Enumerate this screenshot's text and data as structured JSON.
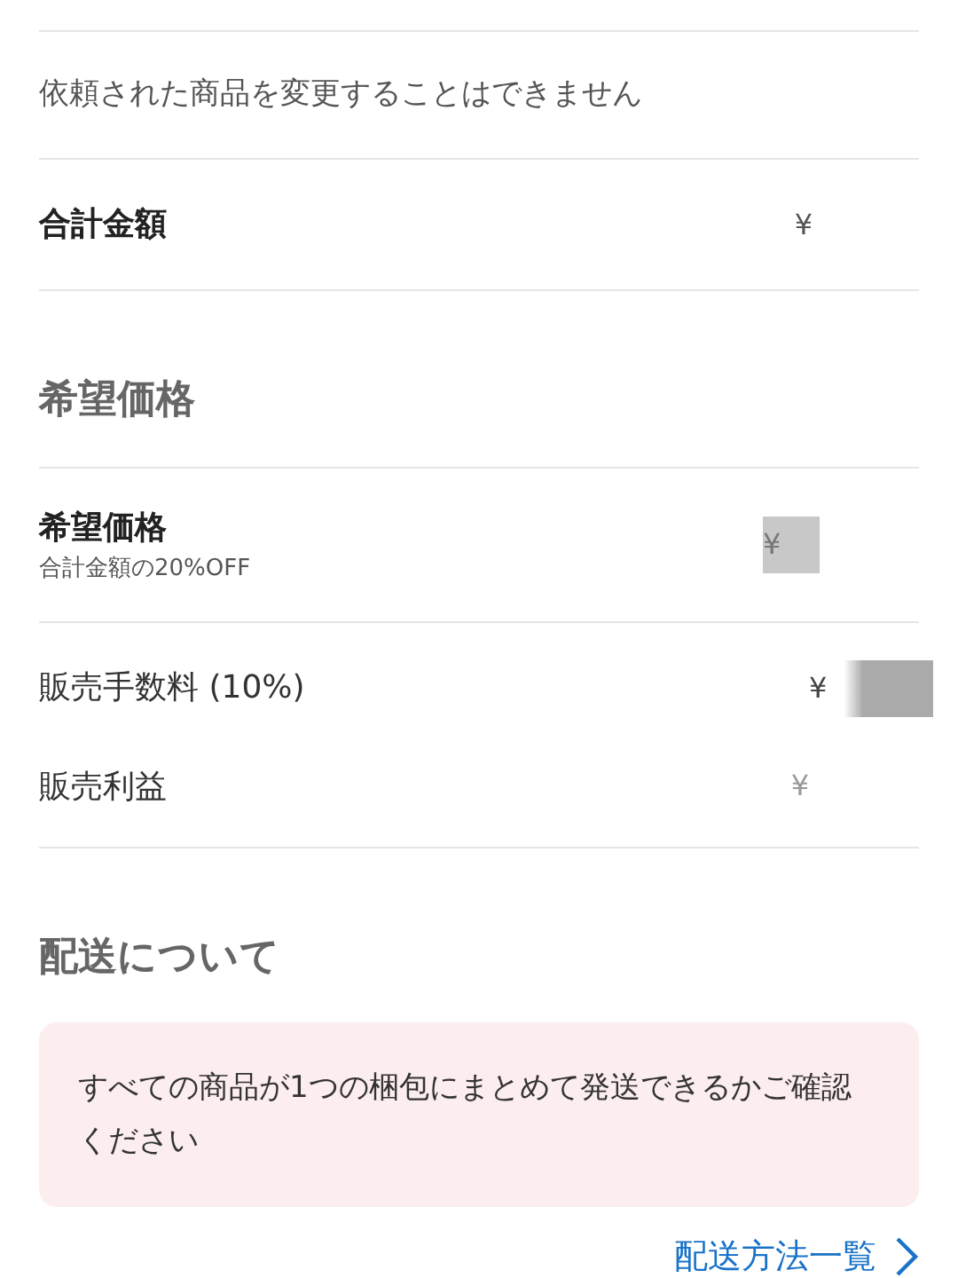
{
  "notice": "依頼された商品を変更することはできません",
  "total": {
    "label": "合計金額",
    "value": "¥"
  },
  "desired_section": {
    "heading": "希望価格"
  },
  "desired_price": {
    "label": "希望価格",
    "sub": "合計金額の20%OFF",
    "value": "¥"
  },
  "fees": [
    {
      "label": "販売手数料 (10%)",
      "value": "¥"
    },
    {
      "label": "販売利益",
      "value": "¥"
    }
  ],
  "shipping": {
    "heading": "配送について",
    "alert": "すべての商品が1つの梱包にまとめて発送できるかご確認ください",
    "link": "配送方法一覧"
  }
}
